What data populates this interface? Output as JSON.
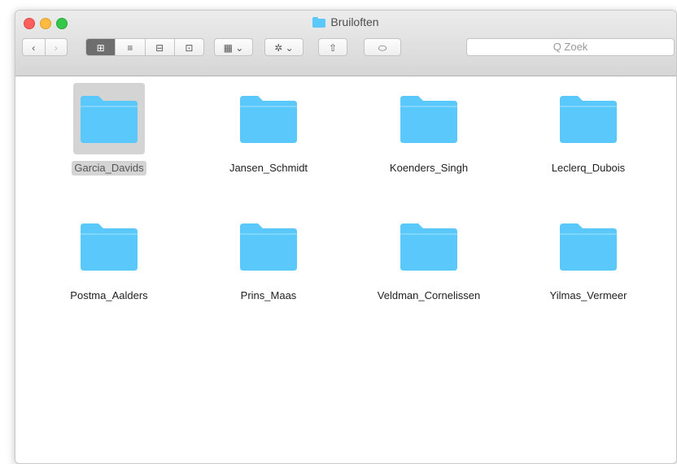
{
  "window": {
    "title": "Bruiloften"
  },
  "toolbar": {
    "back_glyph": "‹",
    "forward_glyph": "›",
    "view_icon_glyph": "⊞",
    "view_list_glyph": "≡",
    "view_column_glyph": "⊟",
    "view_coverflow_glyph": "⊡",
    "arrange_glyph": "▦ ⌄",
    "action_glyph": "✲ ⌄",
    "share_glyph": "⇧",
    "tag_glyph": "⬭",
    "search_placeholder": "Q Zoek"
  },
  "folders": [
    {
      "name": "Garcia_Davids",
      "selected": true
    },
    {
      "name": "Jansen_Schmidt"
    },
    {
      "name": "Koenders_Singh"
    },
    {
      "name": "Leclerq_Dubois"
    },
    {
      "name": "Postma_Aalders"
    },
    {
      "name": "Prins_Maas"
    },
    {
      "name": "Veldman_Cornelissen"
    },
    {
      "name": "Yilmas_Vermeer"
    }
  ],
  "colors": {
    "folder": "#5ac8fa",
    "folder_top": "#7fd6fb",
    "selection": "#d4d4d4"
  }
}
